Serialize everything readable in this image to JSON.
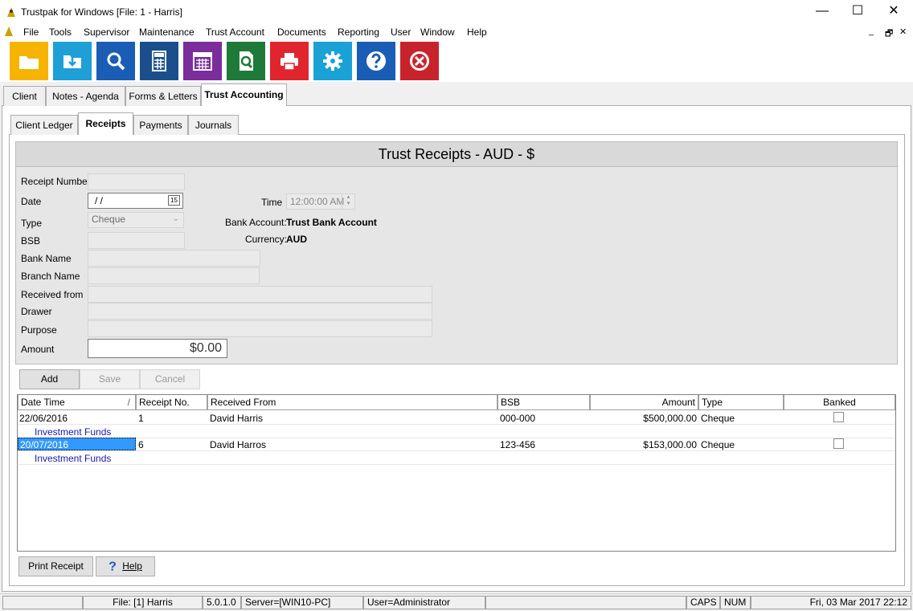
{
  "window": {
    "title": "Trustpak for Windows [File: 1 - Harris]",
    "minimize": "—",
    "maximize": "☐",
    "close": "✕"
  },
  "menu": {
    "items": [
      "File",
      "Tools",
      "Supervisor",
      "Maintenance",
      "Trust Account",
      "Documents",
      "Reporting",
      "User",
      "Window",
      "Help"
    ],
    "mdi_minimize": "_",
    "mdi_restore": "🗗",
    "mdi_close": "✕"
  },
  "toolbar": {
    "colors": [
      "#f6b400",
      "#1e9fd6",
      "#1a5db4",
      "#1a4f8c",
      "#7a2d9b",
      "#1f7a3a",
      "#e0252f",
      "#1aa1d6",
      "#1a5db4",
      "#c8232c"
    ],
    "icons": [
      "folder-icon",
      "download-icon",
      "search-icon",
      "calculator-icon",
      "calendar-icon",
      "document-search-icon",
      "printer-icon",
      "gear-icon",
      "help-icon",
      "exit-icon"
    ]
  },
  "tabs": {
    "main": [
      "Client",
      "Notes - Agenda",
      "Forms & Letters",
      "Trust Accounting"
    ],
    "sub": [
      "Client Ledger",
      "Receipts",
      "Payments",
      "Journals"
    ]
  },
  "form": {
    "header": "Trust Receipts - AUD - $",
    "labels": {
      "receipt_number": "Receipt Number",
      "date": "Date",
      "type": "Type",
      "bsb": "BSB",
      "bank_name": "Bank Name",
      "branch_name": "Branch Name",
      "received_from": "Received from",
      "drawer": "Drawer",
      "purpose": "Purpose",
      "amount": "Amount",
      "time": "Time",
      "bank_account": "Bank Account:",
      "currency": "Currency:"
    },
    "values": {
      "date": " /  /",
      "calendar": "15",
      "type": "Cheque",
      "time": "12:00:00 AM",
      "bank_account": "Trust Bank Account",
      "currency": "AUD",
      "amount": "$0.00"
    }
  },
  "actions": {
    "add": "Add",
    "save": "Save",
    "cancel": "Cancel",
    "print_receipt": "Print Receipt",
    "help": "Help"
  },
  "grid": {
    "columns": [
      "Date Time",
      "Receipt No.",
      "Received From",
      "BSB",
      "Amount",
      "Type",
      "Banked"
    ],
    "sort_indicator": "/",
    "rows": [
      {
        "date": "22/06/2016",
        "receipt_no": "1",
        "received_from": "David Harris",
        "bsb": "000-000",
        "amount": "$500,000.00",
        "type": "Cheque",
        "purpose": "Investment Funds",
        "banked": false
      },
      {
        "date": "20/07/2016",
        "receipt_no": "6",
        "received_from": "David Harros",
        "bsb": "123-456",
        "amount": "$153,000.00",
        "type": "Cheque",
        "purpose": "Investment Funds",
        "banked": false
      }
    ]
  },
  "status": {
    "file": "File: [1] Harris",
    "version": "5.0.1.0",
    "server": "Server=[WIN10-PC]",
    "user": "User=Administrator",
    "caps": "CAPS",
    "num": "NUM",
    "datetime": "Fri, 03 Mar 2017 22:12"
  }
}
